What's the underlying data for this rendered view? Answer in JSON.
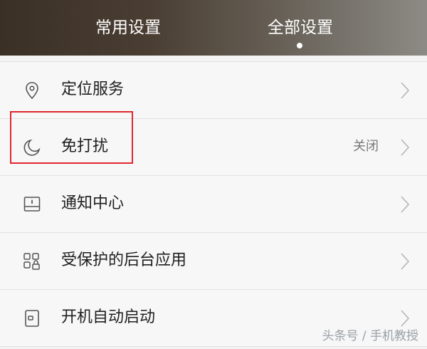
{
  "header": {
    "tabs": [
      {
        "label": "常用设置",
        "active": false
      },
      {
        "label": "全部设置",
        "active": true
      }
    ]
  },
  "settings": [
    {
      "label": "定位服务",
      "status": "",
      "icon": "location-pin-icon"
    },
    {
      "label": "免打扰",
      "status": "关闭",
      "icon": "moon-icon"
    },
    {
      "label": "通知中心",
      "status": "",
      "icon": "notification-tray-icon"
    },
    {
      "label": "受保护的后台应用",
      "status": "",
      "icon": "apps-lock-icon"
    },
    {
      "label": "开机自动启动",
      "status": "",
      "icon": "power-switch-icon"
    }
  ],
  "watermark": "头条号 / 手机教授",
  "colors": {
    "highlight": "#e0262e",
    "background": "#f3f3f3"
  }
}
